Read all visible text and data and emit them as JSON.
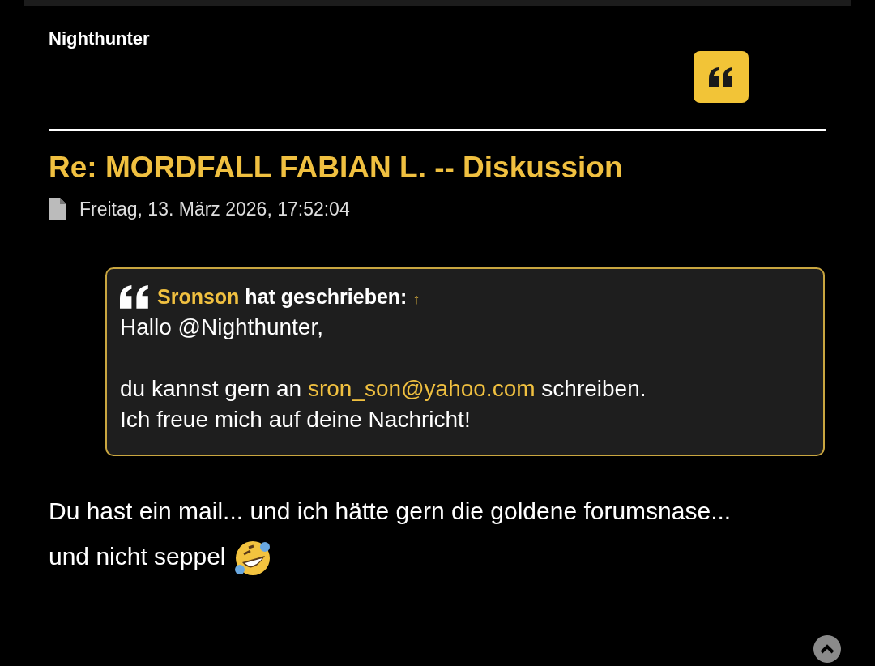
{
  "post": {
    "author": "Nighthunter",
    "title": "Re: MORDFALL FABIAN L. -- Diskussion",
    "date": "Freitag, 13. März 2026, 17:52:04",
    "quote": {
      "author": "Sronson",
      "header": "hat geschrieben:",
      "jump": "↑",
      "greeting": "Hallo @Nighthunter,",
      "before": "du kannst gern an ",
      "email": "sron_son@yahoo.com",
      "after": " schreiben.",
      "closing": "Ich freue mich auf deine Nachricht!"
    },
    "body": "Du hast ein mail... und ich hätte gern die goldene forumsnase... und nicht seppel"
  }
}
